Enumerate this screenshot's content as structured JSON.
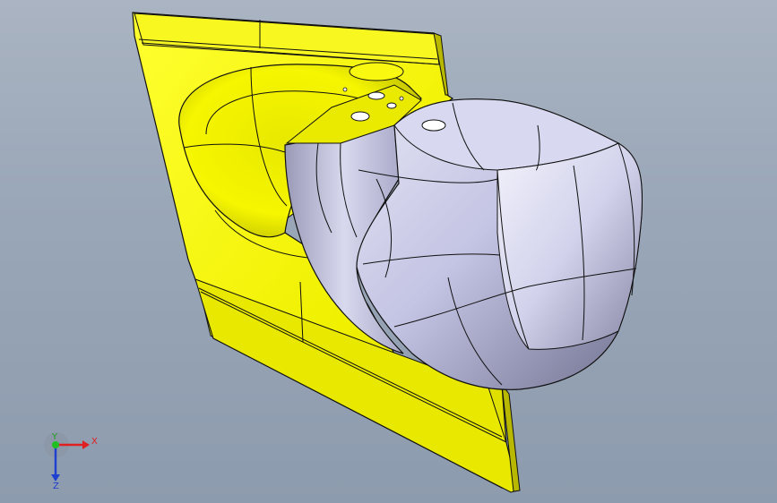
{
  "viewport": {
    "background_top": "#aab4c2",
    "background_bottom": "#8d9bae"
  },
  "model": {
    "plate_color": "#f2f200",
    "plate_shadow": "#c9c900",
    "body_color": "#c8c8e6",
    "edge_color": "#111111"
  },
  "triad": {
    "x_label": "X",
    "y_label": "Y",
    "z_label": "Z",
    "x_color": "#e02020",
    "y_color": "#20c020",
    "z_color": "#2040d0"
  }
}
